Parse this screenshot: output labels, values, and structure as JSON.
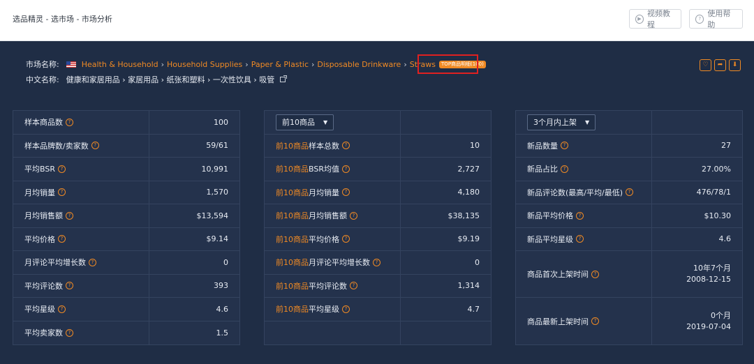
{
  "header": {
    "breadcrumb": "选品精灵 - 选市场 - 市场分析",
    "video_btn": "视频教程",
    "help_btn": "使用帮助"
  },
  "market": {
    "market_label": "市场名称:",
    "categories": [
      "Health & Household",
      "Household Supplies",
      "Paper & Plastic",
      "Disposable Drinkware",
      "Straws"
    ],
    "separator": "›",
    "badge": "TOP商品明细(100)",
    "cn_label": "中文名称:",
    "cn_path": "健康和家居用品 › 家居用品 › 纸张和塑料 › 一次性饮具 › 吸管"
  },
  "panel1": {
    "rows": [
      {
        "label": "样本商品数",
        "value": "100"
      },
      {
        "label": "样本品牌数/卖家数",
        "value": "59/61"
      },
      {
        "label": "平均BSR",
        "value": "10,991"
      },
      {
        "label": "月均销量",
        "value": "1,570"
      },
      {
        "label": "月均销售额",
        "value": "$13,594"
      },
      {
        "label": "平均价格",
        "value": "$9.14"
      },
      {
        "label": "月评论平均增长数",
        "value": "0"
      },
      {
        "label": "平均评论数",
        "value": "393"
      },
      {
        "label": "平均星级",
        "value": "4.6"
      },
      {
        "label": "平均卖家数",
        "value": "1.5"
      }
    ]
  },
  "panel2": {
    "select": "前10商品",
    "prefix": "前10商品",
    "rows": [
      {
        "label": "样本总数",
        "value": "10"
      },
      {
        "label": "BSR均值",
        "value": "2,727"
      },
      {
        "label": "月均销量",
        "value": "4,180"
      },
      {
        "label": "月均销售额",
        "value": "$38,135"
      },
      {
        "label": "平均价格",
        "value": "$9.19"
      },
      {
        "label": "月评论平均增长数",
        "value": "0"
      },
      {
        "label": "平均评论数",
        "value": "1,314"
      },
      {
        "label": "平均星级",
        "value": "4.7"
      }
    ]
  },
  "panel3": {
    "select": "3个月内上架",
    "rows": [
      {
        "label": "新品数量",
        "value": "27"
      },
      {
        "label": "新品占比",
        "value": "27.00%"
      },
      {
        "label": "新品评论数(最高/平均/最低)",
        "value": "476/78/1"
      },
      {
        "label": "新品平均价格",
        "value": "$10.30"
      },
      {
        "label": "新品平均星级",
        "value": "4.6"
      }
    ],
    "first_listed": {
      "label": "商品首次上架时间",
      "value1": "10年7个月",
      "value2": "2008-12-15"
    },
    "latest_listed": {
      "label": "商品最新上架时间",
      "value1": "0个月",
      "value2": "2019-07-04"
    }
  },
  "icons": {
    "help": "question-circle-icon",
    "video": "play-circle-icon",
    "favorite": "heart-icon",
    "share": "share-icon",
    "download": "download-icon"
  },
  "colors": {
    "accent": "#f08a24",
    "panel_bg": "#24324c",
    "page_bg": "#1f2d45"
  }
}
